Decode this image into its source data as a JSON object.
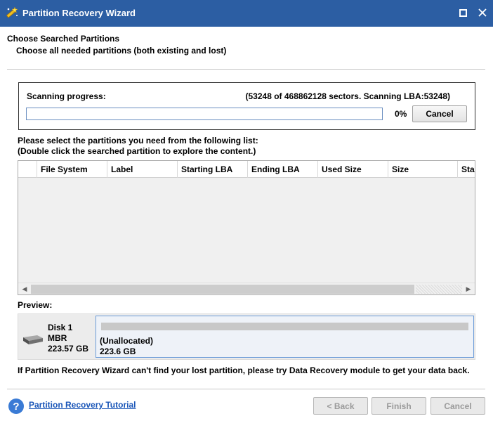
{
  "window": {
    "title": "Partition Recovery Wizard"
  },
  "page": {
    "heading": "Choose Searched Partitions",
    "subheading": "Choose all needed partitions (both existing and lost)"
  },
  "scan": {
    "label": "Scanning progress:",
    "status": "(53248 of 468862128 sectors. Scanning LBA:53248)",
    "percent_text": "0%",
    "progress_fraction": 0.0,
    "cancel_label": "Cancel"
  },
  "instructions": {
    "line1": "Please select the partitions you need from the following list:",
    "line2": "(Double click the searched partition to explore the content.)"
  },
  "table": {
    "columns": [
      "",
      "File System",
      "Label",
      "Starting LBA",
      "Ending LBA",
      "Used Size",
      "Size",
      "Sta"
    ],
    "rows": []
  },
  "preview": {
    "label": "Preview:",
    "disk": {
      "name": "Disk 1",
      "type": "MBR",
      "size": "223.57 GB"
    },
    "partition": {
      "name": "(Unallocated)",
      "size": "223.6 GB"
    }
  },
  "footer_note": "If Partition Recovery Wizard can't find your lost partition, please try Data Recovery module to get your data back.",
  "bottom": {
    "tutorial_link": "Partition Recovery Tutorial",
    "back_label": "< Back",
    "finish_label": "Finish",
    "cancel_label": "Cancel"
  },
  "colors": {
    "titlebar": "#2c5ea3",
    "link": "#1a56b8",
    "progress": "#3c7fd0"
  }
}
